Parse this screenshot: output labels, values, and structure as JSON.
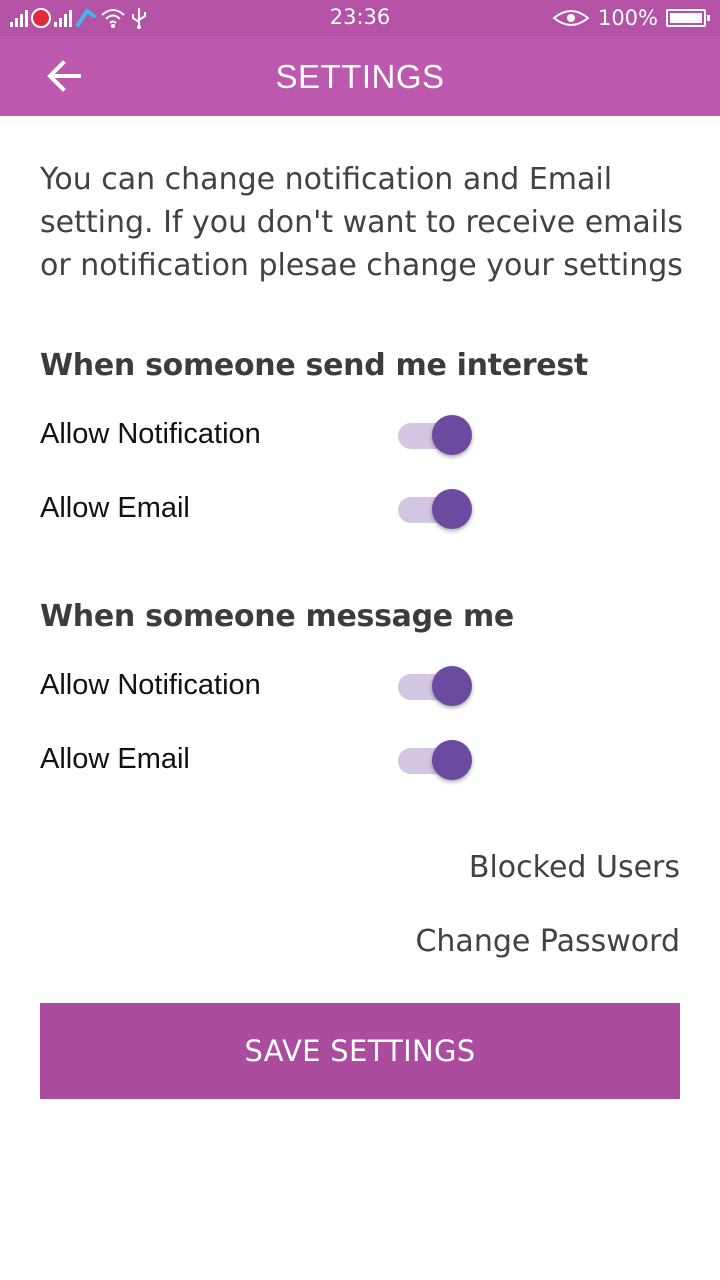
{
  "status_bar": {
    "time": "23:36",
    "battery_percent": "100%",
    "icons": [
      "signal-icon",
      "carrier-icon",
      "signal-icon",
      "carrier-icon",
      "wifi-icon",
      "usb-icon",
      "eye-icon",
      "battery-icon"
    ]
  },
  "app_bar": {
    "title": "SETTINGS",
    "back_icon": "arrow-left-icon"
  },
  "intro_text": "You can change notification and Email setting. If you don't want to receive emails or notification plesae change your settings",
  "sections": [
    {
      "title": "When someone send me interest",
      "rows": [
        {
          "label": "Allow Notification",
          "enabled": true
        },
        {
          "label": "Allow Email",
          "enabled": true
        }
      ]
    },
    {
      "title": "When someone message me",
      "rows": [
        {
          "label": "Allow Notification",
          "enabled": true
        },
        {
          "label": "Allow Email",
          "enabled": true
        }
      ]
    }
  ],
  "links": {
    "blocked_users": "Blocked Users",
    "change_password": "Change Password"
  },
  "save_button": "SAVE SETTINGS",
  "colors": {
    "status_bar": "#b452a6",
    "app_bar": "#bc58ad",
    "save_button": "#ab4c9e",
    "switch_thumb": "#6a4ba0",
    "switch_track": "#d3c6e2"
  }
}
